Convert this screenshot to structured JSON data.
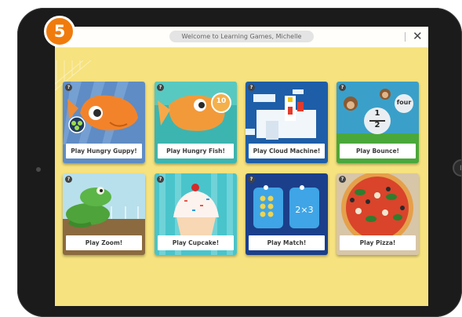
{
  "step": {
    "number": "5"
  },
  "header": {
    "welcome": "Welcome to Learning Games, Michelle",
    "close_glyph": "✕"
  },
  "games": [
    {
      "label": "Play Hungry Guppy!",
      "help": "?"
    },
    {
      "label": "Play Hungry Fish!",
      "help": "?",
      "badge": "10"
    },
    {
      "label": "Play Cloud Machine!",
      "help": "?"
    },
    {
      "label": "Play Bounce!",
      "help": "?",
      "word": "four",
      "frac_num": "1",
      "frac_den": "2"
    },
    {
      "label": "Play Zoom!",
      "help": "?"
    },
    {
      "label": "Play Cupcake!",
      "help": "?"
    },
    {
      "label": "Play Match!",
      "help": "?",
      "expr": "2×3"
    },
    {
      "label": "Play Pizza!",
      "help": "?"
    }
  ],
  "colors": {
    "screen_bg": "#f6e27e",
    "badge": "#f07b0c",
    "bezel": "#1b1b1b"
  }
}
